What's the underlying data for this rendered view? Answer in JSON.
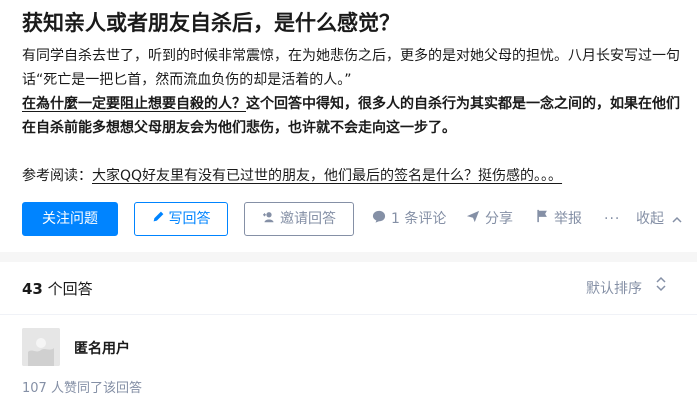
{
  "question": {
    "title": "获知亲人或者朋友自杀后，是什么感觉？",
    "detail_p1": "有同学自杀去世了，听到的时候非常震惊，在为她悲伤之后，更多的是对她父母的担忧。八月长安写过一句话“死亡是一把匕首，然而流血负伤的却是活着的人。”",
    "detail_p2_underlined": "在為什麼一定要阻止想要自殺的人？",
    "detail_p2_rest": "这个回答中得知，很多人的自杀行为其实都是一念之间的，如果在他们在自杀前能多想想父母朋友会为他们悲伤，也许就不会走向这一步了。",
    "reference_label": "参考阅读：",
    "reference_link": "大家QQ好友里有没有已过世的朋友，他们最后的签名是什么？挺伤感的。。。"
  },
  "actions": {
    "follow_label": "关注问题",
    "write_label": "写回答",
    "invite_label": "邀请回答",
    "comment_label": "1 条评论",
    "share_label": "分享",
    "report_label": "举报",
    "more_label": "···",
    "collapse_label": "收起"
  },
  "answers": {
    "count_number": "43",
    "count_label": " 个回答",
    "sort_label": "默认排序",
    "first_answer": {
      "author": "匿名用户",
      "votes_text": "107 人赞同了该回答"
    }
  },
  "colors": {
    "accent": "#0084ff",
    "muted": "#8590a6",
    "text": "#1a1a1a",
    "page_bg": "#f6f6f6"
  },
  "icons": [
    "pen-icon",
    "add-user-icon",
    "comment-icon",
    "share-icon",
    "flag-icon",
    "more-icon",
    "chevron-up-icon",
    "sort-icon",
    "anonymous-avatar"
  ]
}
